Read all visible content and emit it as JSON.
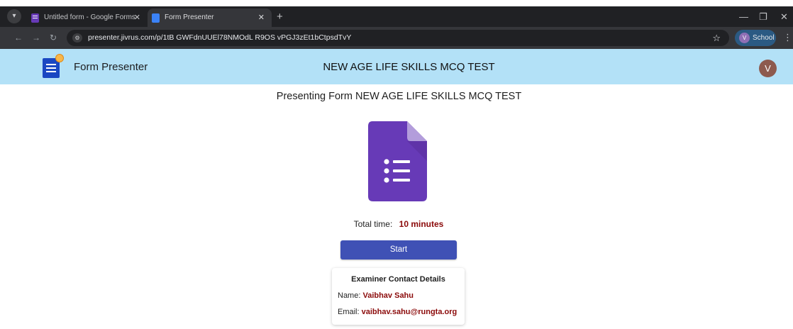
{
  "browser": {
    "tabs": [
      {
        "title": "Untitled form - Google Forms",
        "active": false,
        "favicon": "google-forms-icon"
      },
      {
        "title": "Form Presenter",
        "active": true,
        "favicon": "form-presenter-icon"
      }
    ],
    "new_tab": "+",
    "url": "presenter.jivrus.com/p/1tB GWFdnUUEl78NMOdL R9OS vPGJ3zEt1bCtpsdTvY",
    "profile": {
      "initial": "V",
      "label": "School"
    },
    "icons": {
      "menu": "▾",
      "close": "✕",
      "back": "←",
      "forward": "→",
      "reload": "↻",
      "star": "☆",
      "minimize": "—",
      "restore": "❐",
      "window_close": "✕",
      "kebab": "⋮",
      "site_info": "⚙"
    }
  },
  "header": {
    "app_name": "Form Presenter",
    "title": "NEW AGE LIFE SKILLS MCQ TEST",
    "user_initial": "V",
    "background": "#b3e1f7"
  },
  "main": {
    "presenting_title": "Presenting Form NEW AGE LIFE SKILLS MCQ TEST",
    "total_time_label": "Total time:",
    "total_time_value": "10 minutes",
    "start_label": "Start",
    "start_color": "#3f51b5",
    "contact": {
      "title": "Examiner Contact Details",
      "name_label": "Name:",
      "name": "Vaibhav Sahu",
      "email_label": "Email:",
      "email": "vaibhav.sahu@rungta.org"
    },
    "accent_value_color": "#8b0a0a"
  }
}
